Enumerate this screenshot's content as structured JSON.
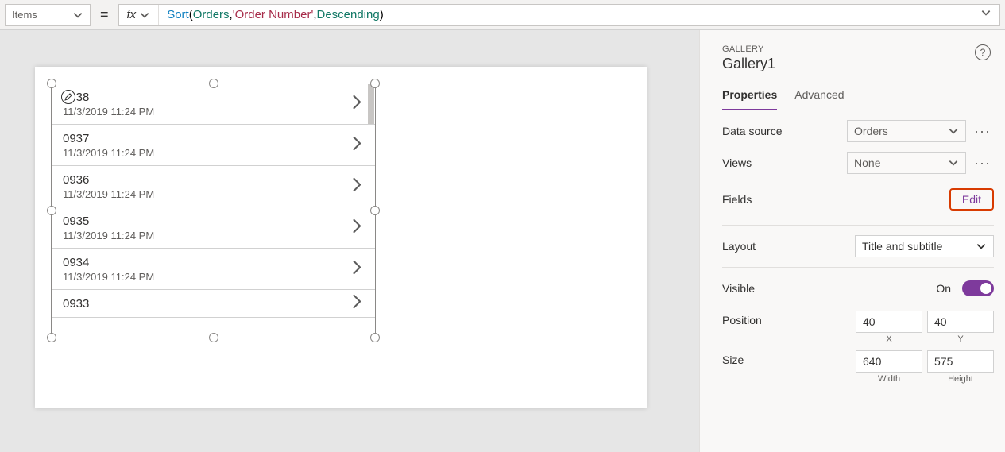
{
  "formulaBar": {
    "property": "Items",
    "equals": "=",
    "fx": "fx",
    "tokens": {
      "sort": "Sort",
      "open": "( ",
      "orders": "Orders",
      "comma1": ", ",
      "orderNum": "'Order Number'",
      "comma2": ", ",
      "desc": "Descending",
      "close": " )"
    }
  },
  "gallery": {
    "items": [
      {
        "title": "0938",
        "sub": "11/3/2019 11:24 PM"
      },
      {
        "title": "0937",
        "sub": "11/3/2019 11:24 PM"
      },
      {
        "title": "0936",
        "sub": "11/3/2019 11:24 PM"
      },
      {
        "title": "0935",
        "sub": "11/3/2019 11:24 PM"
      },
      {
        "title": "0934",
        "sub": "11/3/2019 11:24 PM"
      },
      {
        "title": "0933",
        "sub": ""
      }
    ]
  },
  "panel": {
    "type": "GALLERY",
    "name": "Gallery1",
    "tabs": {
      "properties": "Properties",
      "advanced": "Advanced"
    },
    "rows": {
      "dataSource": {
        "label": "Data source",
        "value": "Orders"
      },
      "views": {
        "label": "Views",
        "value": "None"
      },
      "fields": {
        "label": "Fields",
        "edit": "Edit"
      },
      "layout": {
        "label": "Layout",
        "value": "Title and subtitle"
      },
      "visible": {
        "label": "Visible",
        "state": "On"
      },
      "position": {
        "label": "Position",
        "x": "40",
        "y": "40",
        "xl": "X",
        "yl": "Y"
      },
      "size": {
        "label": "Size",
        "w": "640",
        "h": "575",
        "wl": "Width",
        "hl": "Height"
      }
    }
  }
}
